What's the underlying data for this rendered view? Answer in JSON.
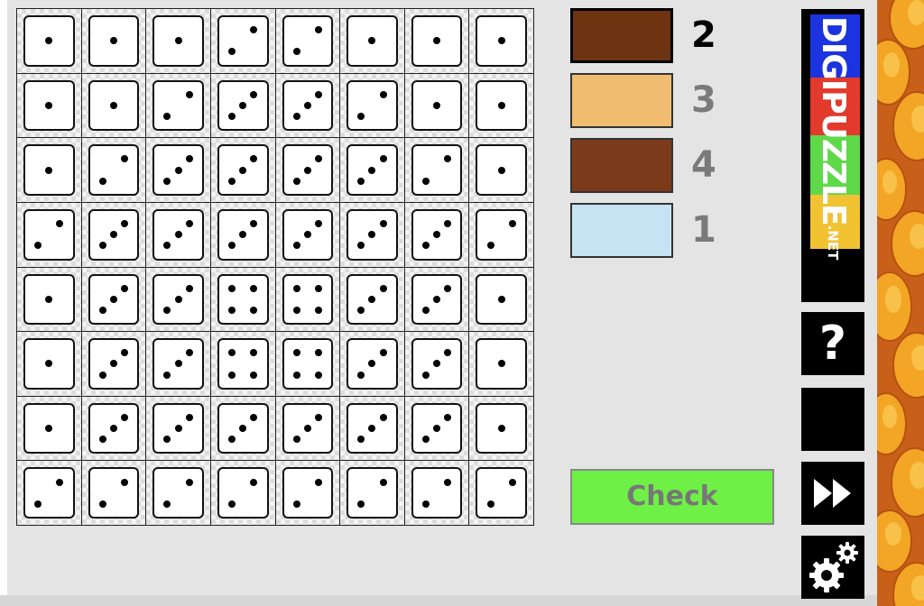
{
  "board": {
    "rows": [
      [
        1,
        1,
        1,
        2,
        2,
        1,
        1,
        1
      ],
      [
        1,
        1,
        2,
        3,
        3,
        2,
        1,
        1
      ],
      [
        1,
        2,
        3,
        3,
        3,
        3,
        2,
        1
      ],
      [
        2,
        3,
        3,
        3,
        3,
        3,
        3,
        2
      ],
      [
        1,
        3,
        3,
        4,
        4,
        3,
        3,
        1
      ],
      [
        1,
        3,
        3,
        4,
        4,
        3,
        3,
        1
      ],
      [
        1,
        3,
        3,
        3,
        3,
        3,
        3,
        1
      ],
      [
        2,
        2,
        2,
        2,
        2,
        2,
        2,
        2
      ]
    ]
  },
  "palette": {
    "selected_index": 0,
    "swatches": [
      {
        "color": "#6e3412",
        "count": "2"
      },
      {
        "color": "#f0bd70",
        "count": "3"
      },
      {
        "color": "#7b3b1b",
        "count": "4"
      },
      {
        "color": "#c5e3f2",
        "count": "1"
      }
    ]
  },
  "check_label": "Check",
  "logo": {
    "text": "DIGIPUZZLE",
    "suffix": ".NET",
    "band_colors": [
      "#1b34e0",
      "#e23a2c",
      "#5fd84a",
      "#f1c232"
    ]
  },
  "icons": {
    "help": "question-mark-icon",
    "help_glyph": "?",
    "skip": "fast-forward-icon",
    "settings": "gears-icon"
  },
  "colors": {
    "check_button": "#6ef047",
    "background_art": "#c8601a"
  }
}
